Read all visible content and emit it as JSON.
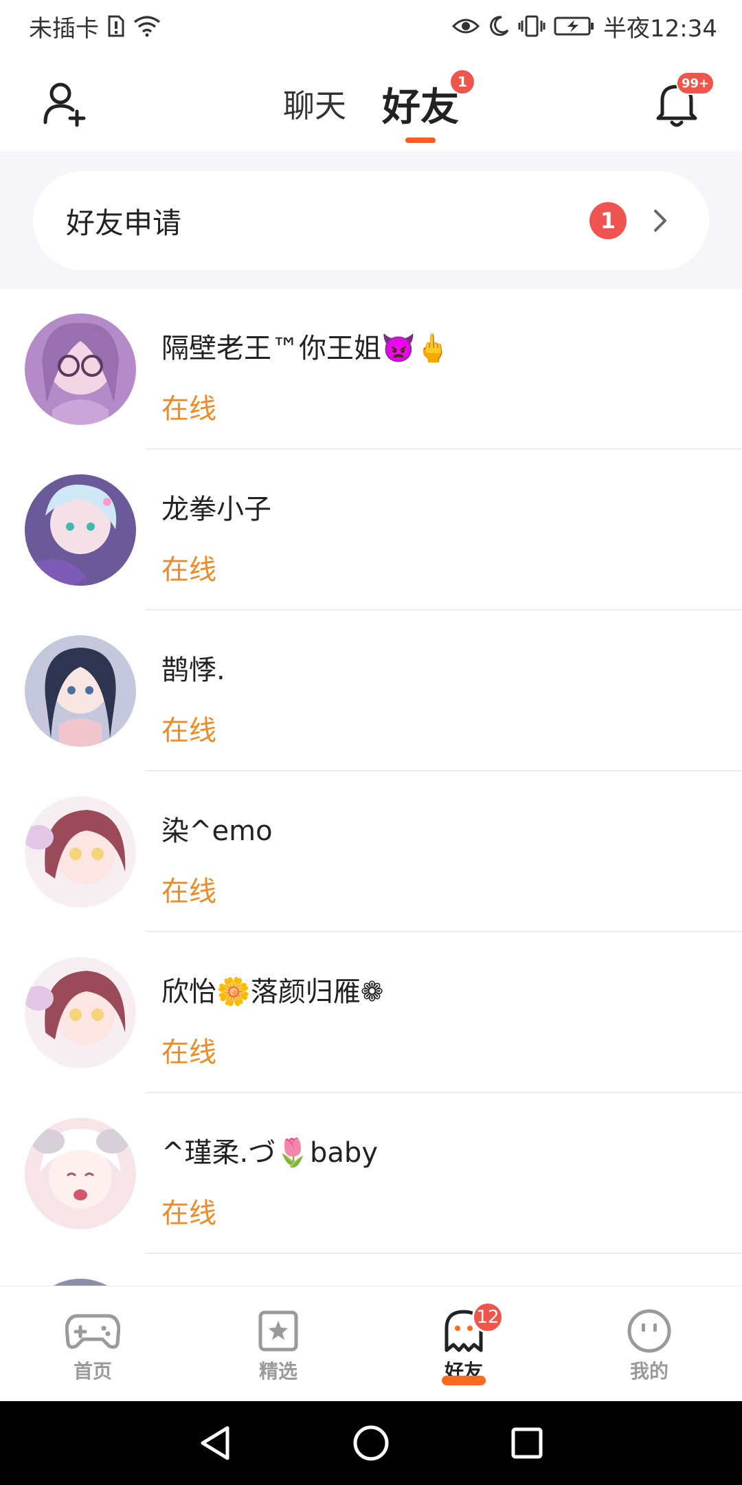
{
  "status_bar": {
    "carrier": "未插卡",
    "time": "半夜12:34"
  },
  "header": {
    "tabs": [
      {
        "label": "聊天",
        "active": false
      },
      {
        "label": "好友",
        "active": true,
        "badge": "1"
      }
    ],
    "bell_badge": "99+"
  },
  "friend_request": {
    "label": "好友申请",
    "count": "1"
  },
  "friends": [
    {
      "name": "隔壁老王™你王姐👿🖕",
      "status": "在线"
    },
    {
      "name": "龙拳小子",
      "status": "在线"
    },
    {
      "name": "鹊悸.",
      "status": "在线"
    },
    {
      "name": "染^emo",
      "status": "在线"
    },
    {
      "name": "欣怡🌼落颜归雁❁",
      "status": "在线"
    },
    {
      "name": "^瑾柔.づ🌷baby",
      "status": "在线"
    }
  ],
  "bottom_nav": [
    {
      "label": "首页",
      "icon": "gamepad-icon",
      "active": false
    },
    {
      "label": "精选",
      "icon": "star-bookmark-icon",
      "active": false
    },
    {
      "label": "好友",
      "icon": "ghost-icon",
      "active": true,
      "badge": "12"
    },
    {
      "label": "我的",
      "icon": "face-icon",
      "active": false
    }
  ],
  "colors": {
    "accent": "#ff5a1f",
    "online": "#f08a24",
    "badge": "#f0554b"
  }
}
